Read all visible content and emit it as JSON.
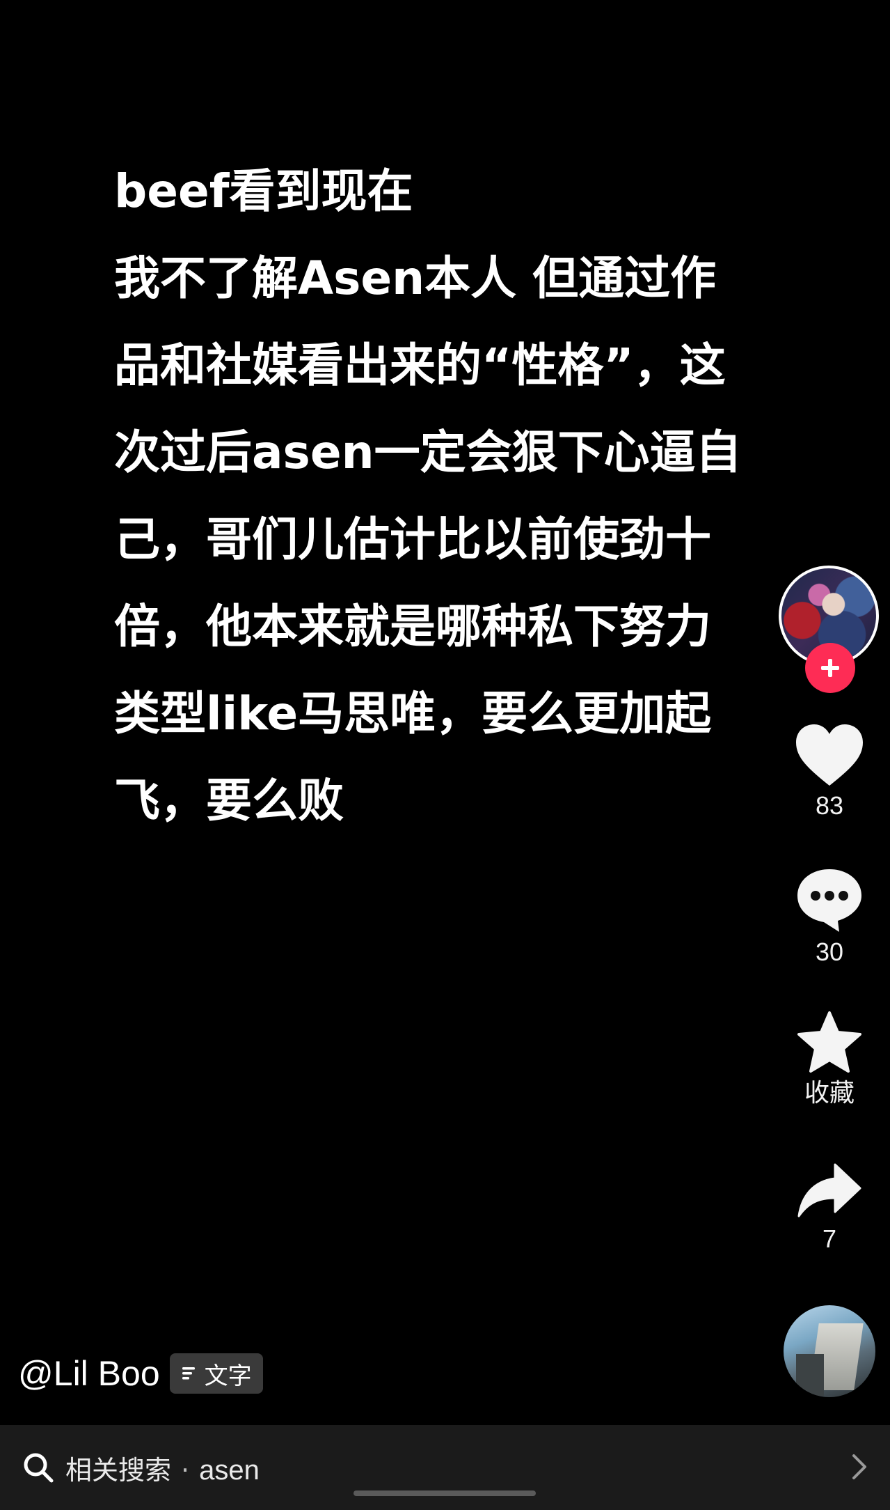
{
  "post": {
    "lines": [
      "beef看到现在",
      "我不了解Asen本人 但通过作",
      "品和社媒看出来的“性格”，这",
      "次过后asen一定会狠下心逼自",
      "己，哥们儿估计比以前使劲十",
      "倍，他本来就是哪种私下努力",
      "类型like马思唯，要么更加起",
      "飞，要么败"
    ]
  },
  "rail": {
    "avatar_icon": "creator-avatar",
    "follow_icon": "plus-icon",
    "like_count": "83",
    "comment_count": "30",
    "favorite_label": "收藏",
    "share_count": "7",
    "music_icon": "music-disc"
  },
  "author": {
    "name": "@Lil Boo",
    "tag_label": "文字"
  },
  "search": {
    "label": "相关搜索",
    "separator": "·",
    "keyword": "asen"
  },
  "colors": {
    "background": "#000000",
    "accent": "#fe2c55",
    "bar": "#1b1b1b"
  }
}
